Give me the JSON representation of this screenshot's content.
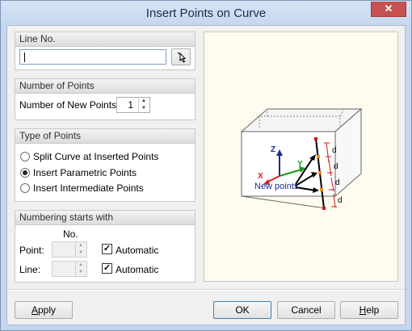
{
  "window": {
    "title": "Insert Points on Curve",
    "close_glyph": "✕"
  },
  "line_group": {
    "header": "Line No.",
    "value": ""
  },
  "points_group": {
    "header": "Number of Points",
    "label": "Number of New Points:",
    "count": "1"
  },
  "type_group": {
    "header": "Type of Points",
    "options": [
      {
        "label": "Split Curve at Inserted Points",
        "selected": false
      },
      {
        "label": "Insert Parametric Points",
        "selected": true
      },
      {
        "label": "Insert Intermediate Points",
        "selected": false
      }
    ]
  },
  "numbering_group": {
    "header": "Numbering starts with",
    "col_header": "No.",
    "point_label": "Point:",
    "line_label": "Line:",
    "automatic_label": "Automatic",
    "point_automatic": true,
    "line_automatic": true
  },
  "diagram": {
    "label_z": "Z",
    "label_x": "X",
    "label_y": "Y",
    "dim_label": "d",
    "callout": "New points"
  },
  "buttons": {
    "apply": "Apply",
    "ok": "OK",
    "cancel": "Cancel",
    "help": "Help"
  },
  "colors": {
    "axis_x": "#d62020",
    "axis_y": "#1a9a1a",
    "axis_z": "#1a2a8a",
    "dims": "#cc1a1a",
    "new_point": "#f08c1a"
  }
}
